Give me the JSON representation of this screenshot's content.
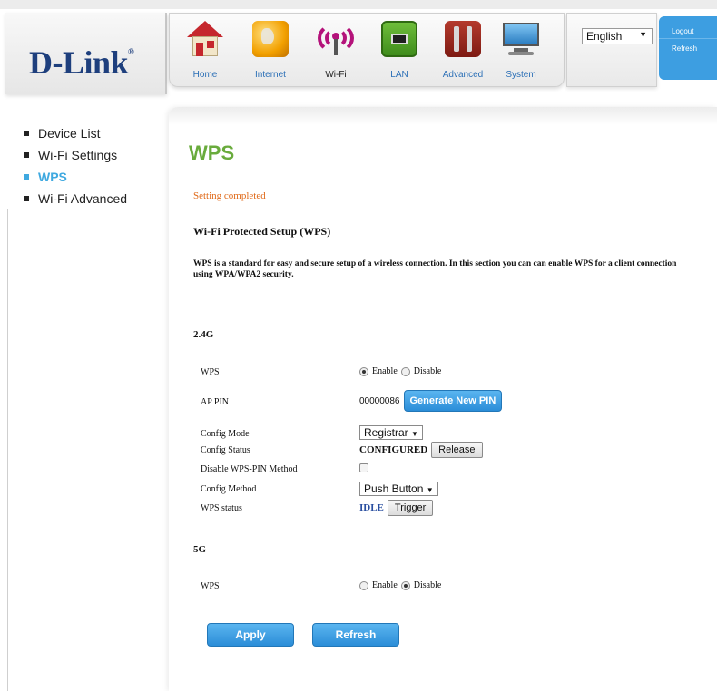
{
  "brand": {
    "logo_text": "D-Link",
    "trademark": "®"
  },
  "top_nav": [
    {
      "label": "Home",
      "icon": "home-icon"
    },
    {
      "label": "Internet",
      "icon": "globe-icon"
    },
    {
      "label": "Wi-Fi",
      "icon": "wifi-icon",
      "active": true
    },
    {
      "label": "LAN",
      "icon": "lan-port-icon"
    },
    {
      "label": "Advanced",
      "icon": "toolbox-icon"
    },
    {
      "label": "System",
      "icon": "monitor-icon"
    }
  ],
  "language": {
    "selected": "English"
  },
  "side_buttons": {
    "logout": "Logout",
    "refresh": "Refresh"
  },
  "sidebar": [
    {
      "label": "Device List"
    },
    {
      "label": "Wi-Fi Settings"
    },
    {
      "label": "WPS",
      "active": true
    },
    {
      "label": "Wi-Fi Advanced"
    }
  ],
  "main": {
    "title": "WPS",
    "status_message": "Setting completed",
    "section_title": "Wi-Fi Protected Setup (WPS)",
    "description": "WPS is a standard for easy and secure setup of a wireless connection. In this section you can can enable WPS for a client connection using WPA/WPA2 security.",
    "band_24": {
      "title": "2.4G",
      "wps_label": "WPS",
      "enable_label": "Enable",
      "disable_label": "Disable",
      "wps_state": "enable",
      "ap_pin_label": "AP PIN",
      "ap_pin_value": "00000086",
      "generate_pin_button": "Generate New PIN",
      "config_mode_label": "Config Mode",
      "config_mode_value": "Registrar",
      "config_status_label": "Config Status",
      "config_status_value": "CONFIGURED",
      "release_button": "Release",
      "disable_pin_label": "Disable WPS-PIN Method",
      "disable_pin_checked": false,
      "config_method_label": "Config Method",
      "config_method_value": "Push Button",
      "wps_status_label": "WPS status",
      "wps_status_value": "IDLE",
      "trigger_button": "Trigger"
    },
    "band_5": {
      "title": "5G",
      "wps_label": "WPS",
      "enable_label": "Enable",
      "disable_label": "Disable",
      "wps_state": "disable"
    },
    "apply_button": "Apply",
    "refresh_button": "Refresh"
  },
  "colors": {
    "title_green": "#69ab3c",
    "accent_blue": "#3fa9e0",
    "status_orange": "#e06a1a",
    "logo_navy": "#1e3f7d"
  }
}
